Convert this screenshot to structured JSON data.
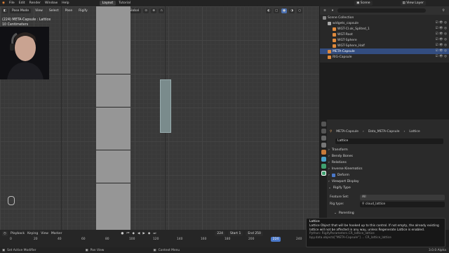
{
  "menu": {
    "items": [
      "File",
      "Edit",
      "Render",
      "Window",
      "Help"
    ],
    "tabs": [
      "Layout",
      "Tutorial"
    ],
    "scene_label": "Scene",
    "view_layer_label": "View Layer"
  },
  "viewport": {
    "mode": "Pose Mode",
    "menus": [
      "View",
      "Select",
      "Pose",
      "Rigify"
    ],
    "orientation": "Global",
    "info_line1": "(224) META-Capsule : Lattice",
    "info_line2": "10 Centimeters"
  },
  "outliner": {
    "rows": [
      {
        "label": "Scene Collection",
        "indent": 0,
        "color": "#888888",
        "selected": false
      },
      {
        "label": "widgets_capsule",
        "indent": 1,
        "color": "#aaaaaa",
        "selected": false
      },
      {
        "label": "WGT-Cl.ok_Splited_1",
        "indent": 2,
        "color": "#e08a3c",
        "selected": false
      },
      {
        "label": "WGT-Root",
        "indent": 2,
        "color": "#e08a3c",
        "selected": false
      },
      {
        "label": "WGT-Sphere",
        "indent": 2,
        "color": "#e08a3c",
        "selected": false
      },
      {
        "label": "WGT-Sphere_Half",
        "indent": 2,
        "color": "#e08a3c",
        "selected": false
      },
      {
        "label": "META-Capsule",
        "indent": 1,
        "color": "#e08a3c",
        "selected": true
      },
      {
        "label": "RIG-Capsule",
        "indent": 1,
        "color": "#e08a3c",
        "selected": false
      }
    ]
  },
  "properties": {
    "breadcrumb": [
      "META-Capsule",
      "Data_META-Capsule",
      "Lattice"
    ],
    "name_field": "Lattice",
    "sections": [
      "Transform",
      "Bendy Bones",
      "Relations",
      "Inverse Kinematics"
    ],
    "deform_label": "Deform",
    "sections2": [
      "Viewport Display",
      "Rigify Type"
    ],
    "feature_set_label": "Feature Set:",
    "feature_set_value": "All",
    "rig_type_label": "Rig type:",
    "rig_type_value": "cloud_lattice",
    "parenting_label": "Parenting"
  },
  "timeline": {
    "menus": [
      "Playback",
      "Keying",
      "View",
      "Marker"
    ],
    "current_frame": "224",
    "start_label": "Start",
    "start_value": "1",
    "end_label": "End",
    "end_value": "250",
    "ticks": [
      "0",
      "20",
      "40",
      "60",
      "80",
      "100",
      "120",
      "140",
      "160",
      "180",
      "200",
      "220",
      "240"
    ]
  },
  "tooltip": {
    "title": "Lattice",
    "line1": "Lattice Object that will be hooked up to this control. If not empty, the already existing",
    "line2": "lattice will not be affected in any way, unless Regenerate Lattice is enabled.",
    "python1": "Python: RigifyParameters.CR_lattice_lattice",
    "python2": "bpy.data.objects[\"META-Capsule\"] ... CR_lattice_lattice"
  },
  "statusbar": {
    "left": "Set Active Modifier",
    "mid": "Pan View",
    "right": "Context Menu",
    "version": "3.0.0 Alpha"
  }
}
